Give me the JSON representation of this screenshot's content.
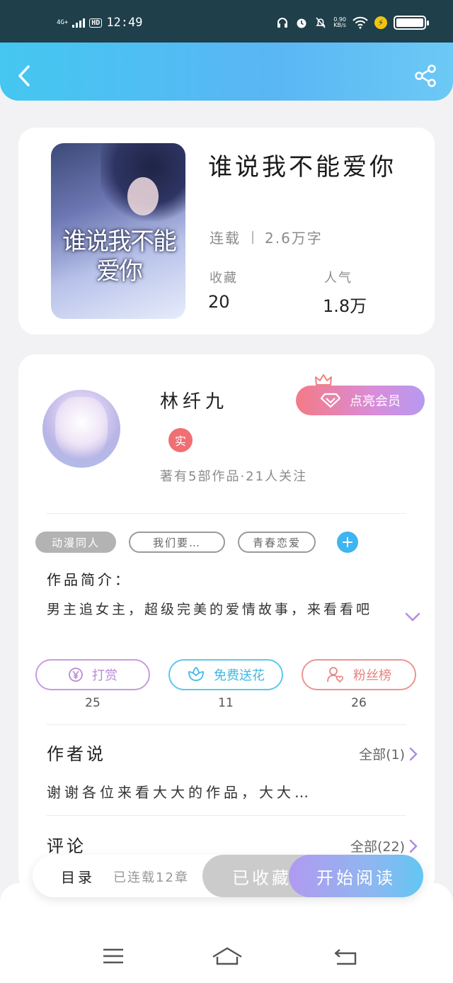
{
  "status_bar": {
    "network": "4G+",
    "hd": "HD",
    "time": "12:49",
    "speed_value": "0.90",
    "speed_unit": "KB/s"
  },
  "book": {
    "cover_title": "谁说我不能爱你",
    "title": "谁说我不能爱你",
    "status": "连载",
    "word_count": "2.6万字",
    "favorites_label": "收藏",
    "favorites_value": "20",
    "popularity_label": "人气",
    "popularity_value": "1.8万"
  },
  "author": {
    "name": "林纤九",
    "vip_label": "点亮会员",
    "real_badge": "实",
    "stats": "著有5部作品·21人关注"
  },
  "tags": [
    "动漫同人",
    "我们要…",
    "青春恋爱"
  ],
  "tag_add": "+",
  "intro": {
    "label": "作品简介：",
    "text": "男主追女主，超级完美的爱情故事，来看看吧"
  },
  "actions": [
    {
      "label": "打赏",
      "count": "25",
      "color": "#b98ad8"
    },
    {
      "label": "免费送花",
      "count": "11",
      "color": "#4cc1ea"
    },
    {
      "label": "粉丝榜",
      "count": "26",
      "color": "#ea8b86"
    }
  ],
  "author_says": {
    "title": "作者说",
    "more": "全部(1)",
    "text": "谢谢各位来看大大的作品，大大…"
  },
  "comments": {
    "title": "评论",
    "more": "全部(22)"
  },
  "bottom_bar": {
    "toc_label": "目录",
    "toc_status": "已连载12章",
    "favorited_label": "已收藏",
    "read_label": "开始阅读"
  }
}
